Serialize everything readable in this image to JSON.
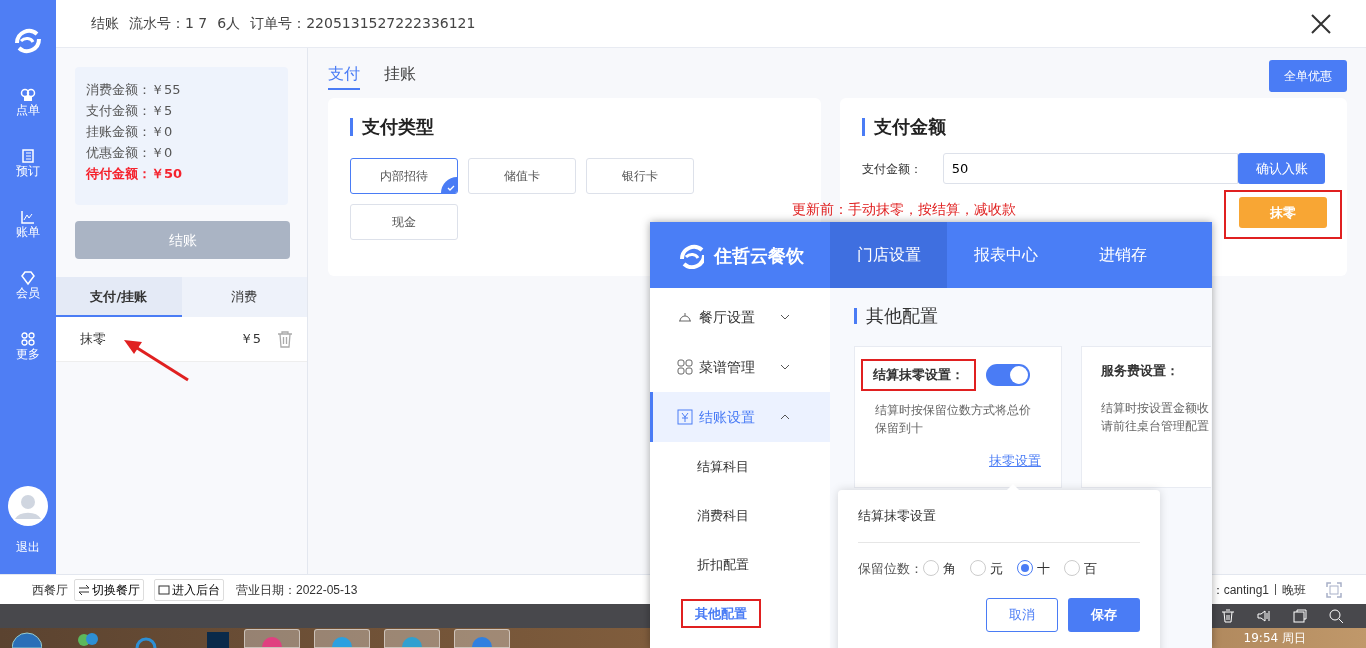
{
  "app_sidebar": {
    "items": [
      {
        "label": "点单",
        "kind": "chef"
      },
      {
        "label": "预订",
        "kind": "book"
      },
      {
        "label": "账单",
        "kind": "chart"
      },
      {
        "label": "会员",
        "kind": "gem"
      },
      {
        "label": "更多",
        "kind": "grid"
      }
    ],
    "logout": "退出"
  },
  "header": {
    "title": "结账",
    "serial": "流水号：1 7",
    "guests": "6人",
    "order": "订单号：2205131527222336121"
  },
  "summary": [
    {
      "text": "消费金额：￥55",
      "kind": "normal"
    },
    {
      "text": "支付金额：￥5",
      "kind": "normal"
    },
    {
      "text": "挂账金额：￥0",
      "kind": "normal"
    },
    {
      "text": "优惠金额：￥0",
      "kind": "normal"
    },
    {
      "text": "待付金额：￥50",
      "kind": "due"
    }
  ],
  "checkout_button": {
    "label": "结账",
    "disabled": true
  },
  "record_tabs": [
    {
      "label": "支付/挂账",
      "selected": true
    },
    {
      "label": "消费",
      "selected": false
    }
  ],
  "records": [
    {
      "name": "抹零",
      "amount": "￥5"
    }
  ],
  "main_tabs": [
    {
      "label": "支付",
      "selected": true
    },
    {
      "label": "挂账",
      "selected": false
    }
  ],
  "discount_button": "全单优惠",
  "payment_types": {
    "title": "支付类型",
    "options": [
      {
        "label": "内部招待",
        "selected": true
      },
      {
        "label": "储值卡",
        "selected": false
      },
      {
        "label": "银行卡",
        "selected": false
      },
      {
        "label": "现金",
        "selected": false
      }
    ]
  },
  "payment_amount": {
    "title": "支付金额",
    "label": "支付金额：",
    "value": "50",
    "confirm": "确认入账",
    "round_button": "抹零"
  },
  "annotation_note": "更新前：手动抹零，按结算，减收款",
  "status_bar": {
    "restaurant": "西餐厅",
    "switch": "切换餐厅",
    "backend": "进入后台",
    "date": "营业日期：2022-05-13",
    "operator": "：canting1",
    "shift": "晚班"
  },
  "taskbar": {
    "clock": "19:54 周日"
  },
  "inset": {
    "brand": "住哲云餐饮",
    "nav": [
      {
        "label": "门店设置",
        "selected": true
      },
      {
        "label": "报表中心",
        "selected": false
      },
      {
        "label": "进销存",
        "selected": false
      }
    ],
    "menu": [
      {
        "label": "餐厅设置",
        "kind": "bell",
        "expanded": false,
        "selected": false
      },
      {
        "label": "菜谱管理",
        "kind": "grid",
        "expanded": false,
        "selected": false
      },
      {
        "label": "结账设置",
        "kind": "yen",
        "expanded": true,
        "selected": true,
        "children": [
          {
            "label": "结算科目",
            "selected": false
          },
          {
            "label": "消费科目",
            "selected": false
          },
          {
            "label": "折扣配置",
            "selected": false
          },
          {
            "label": "其他配置",
            "selected": true
          }
        ]
      }
    ],
    "title": "其他配置",
    "rounding_card": {
      "title": "结算抹零设置：",
      "on": true,
      "description": "结算时按保留位数方式将总价保留到十",
      "link": "抹零设置"
    },
    "service_card": {
      "title": "服务费设置：",
      "lines": [
        "结算时按设置金额收",
        "请前往桌台管理配置"
      ]
    },
    "popover": {
      "title": "结算抹零设置",
      "label": "保留位数：",
      "options": [
        {
          "label": "角",
          "selected": false
        },
        {
          "label": "元",
          "selected": false
        },
        {
          "label": "十",
          "selected": true
        },
        {
          "label": "百",
          "selected": false
        }
      ],
      "cancel": "取消",
      "save": "保存"
    }
  }
}
